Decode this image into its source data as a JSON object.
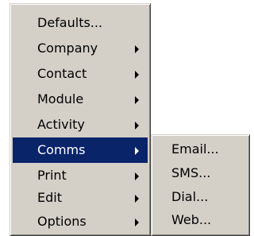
{
  "main_menu": {
    "items": [
      {
        "label": "Defaults...",
        "has_submenu": false
      },
      {
        "label": "Company",
        "has_submenu": true
      },
      {
        "label": "Contact",
        "has_submenu": true
      },
      {
        "label": "Module",
        "has_submenu": true
      },
      {
        "label": "Activity",
        "has_submenu": true
      },
      {
        "label": "Comms",
        "has_submenu": true,
        "selected": true
      },
      {
        "label": "Print",
        "has_submenu": true
      },
      {
        "label": "Edit",
        "has_submenu": true
      },
      {
        "label": "Options",
        "has_submenu": true
      }
    ]
  },
  "sub_menu": {
    "items": [
      {
        "label": "Email..."
      },
      {
        "label": "SMS..."
      },
      {
        "label": "Dial..."
      },
      {
        "label": "Web..."
      }
    ]
  },
  "colors": {
    "menu_face": "#d4d0c8",
    "highlight": "#0a246a",
    "highlight_text": "#ffffff"
  }
}
